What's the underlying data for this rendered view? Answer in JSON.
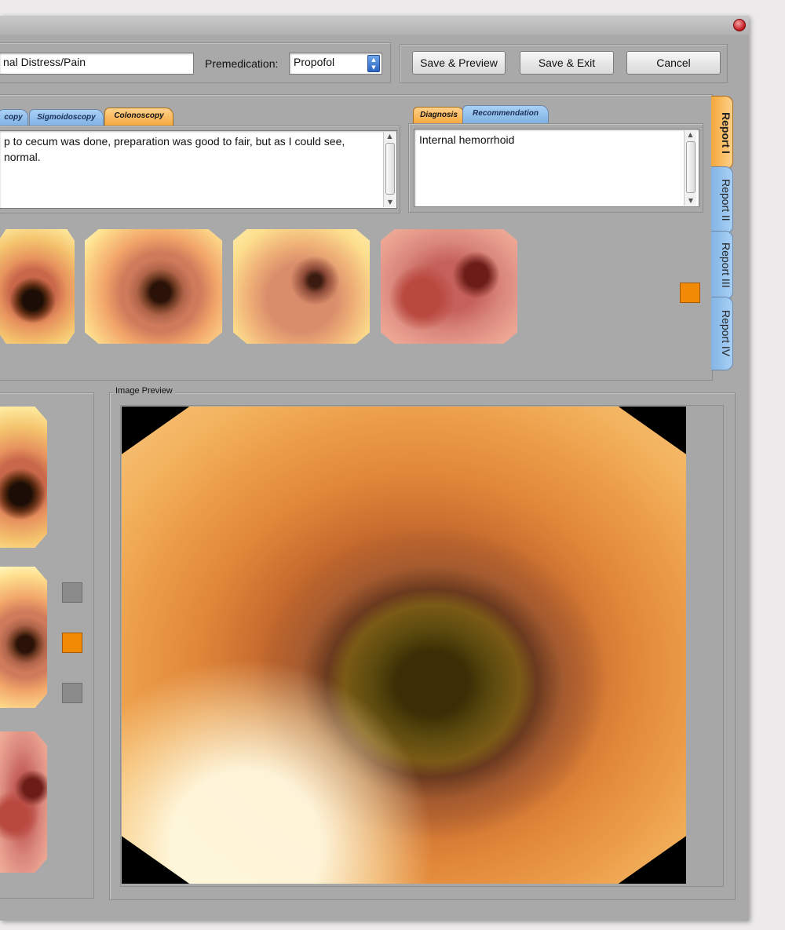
{
  "header": {
    "complaint_value": "nal Distress/Pain",
    "premedication_label": "Premedication:",
    "premedication_value": "Propofol",
    "buttons": {
      "save_preview": "Save & Preview",
      "save_exit": "Save & Exit",
      "cancel": "Cancel"
    }
  },
  "procedure_tabs": {
    "tabs": [
      "copy",
      "Sigmoidoscopy",
      "Colonoscopy"
    ],
    "active": "Colonoscopy",
    "text_line1": "p to cecum was done, preparation was good to fair, but as I could see,",
    "text_line2": "normal."
  },
  "diagnosis_tabs": {
    "tabs": [
      "Diagnosis",
      "Recommendation"
    ],
    "active": "Diagnosis",
    "text": "Internal hemorrhoid"
  },
  "report_tabs": [
    "Report I",
    "Report II",
    "Report III",
    "Report IV"
  ],
  "report_active": "Report I",
  "image_preview": {
    "title": "Image Preview"
  },
  "colors": {
    "accent_orange": "#f38a06",
    "tab_blue": "#8fbfec",
    "tab_orange": "#f5a73b",
    "window_gray": "#a9a9a9"
  }
}
